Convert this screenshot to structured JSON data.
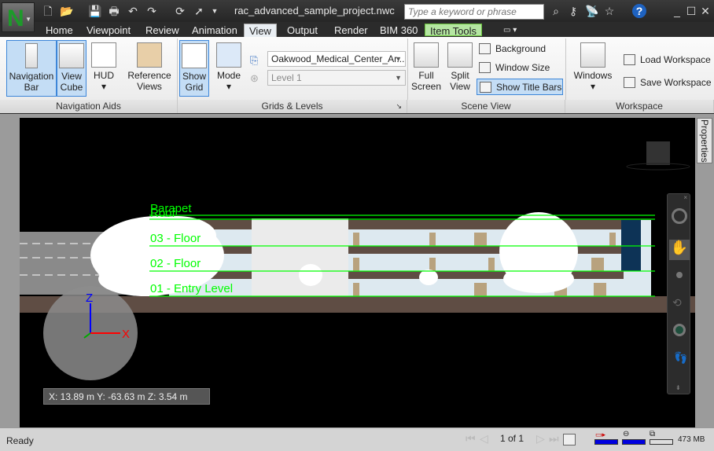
{
  "app": {
    "title": "rac_advanced_sample_project.nwc",
    "logo": "N"
  },
  "search": {
    "placeholder": "Type a keyword or phrase"
  },
  "tabs": [
    {
      "label": "Home"
    },
    {
      "label": "Viewpoint"
    },
    {
      "label": "Review"
    },
    {
      "label": "Animation"
    },
    {
      "label": "View"
    },
    {
      "label": "Output"
    },
    {
      "label": "Render"
    },
    {
      "label": "BIM 360"
    },
    {
      "label": "Item Tools"
    }
  ],
  "ribbon": {
    "navigation_aids": {
      "label": "Navigation Aids",
      "navigation_bar": "Navigation Bar",
      "view_cube": "View Cube",
      "hud": "HUD",
      "reference_views": "Reference Views"
    },
    "grids_levels": {
      "label": "Grids & Levels",
      "show_grid": "Show Grid",
      "mode": "Mode",
      "file_value": "Oakwood_Medical_Center_Ar...",
      "level_value": "Level 1"
    },
    "scene_view": {
      "label": "Scene View",
      "full_screen": "Full Screen",
      "split_view": "Split View",
      "background": "Background",
      "window_size": "Window Size",
      "show_title_bars": "Show Title Bars"
    },
    "workspace": {
      "label": "Workspace",
      "windows": "Windows",
      "load_workspace": "Load Workspace",
      "save_workspace": "Save Workspace"
    }
  },
  "viewport": {
    "levels": [
      "Parapet",
      "Roof",
      "03 - Floor",
      "02 - Floor",
      "01 - Entry Level"
    ],
    "axes": {
      "z": "Z",
      "x": "X"
    },
    "coords": "X: 13.89 m  Y: -63.63 m  Z: 3.54 m",
    "properties_tab": "Properties"
  },
  "status": {
    "ready": "Ready",
    "page": "1 of 1",
    "memory": "473 MB"
  },
  "colors": {
    "grid_line": "#00ff00",
    "accent": "#3d86d8",
    "item_tools": "#b5e6a2"
  }
}
